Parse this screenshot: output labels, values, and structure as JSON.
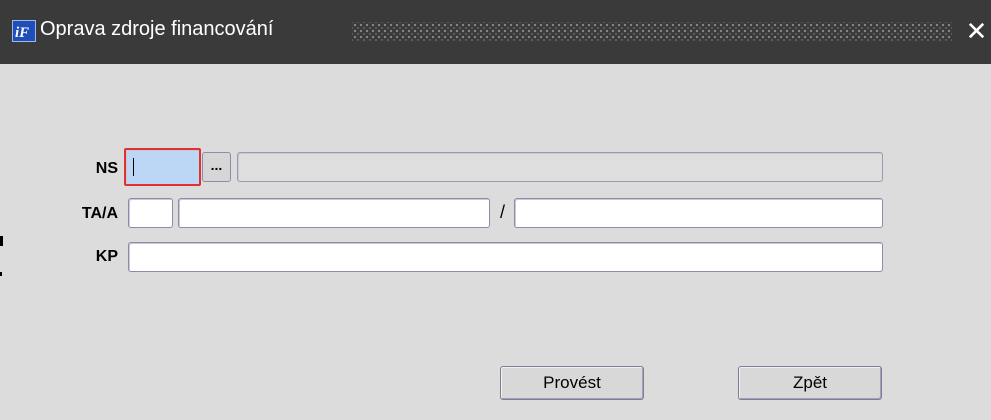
{
  "window": {
    "title": "Oprava zdroje financování",
    "close_glyph": "✕",
    "icon": "app-logo-icon"
  },
  "form": {
    "ns": {
      "label": "NS",
      "code_value": "",
      "lov_label": "...",
      "description_value": ""
    },
    "taa": {
      "label": "TA/A",
      "field1_value": "",
      "field2_value": "",
      "separator": "/",
      "field3_value": ""
    },
    "kp": {
      "label": "KP",
      "value": ""
    }
  },
  "buttons": {
    "execute_label": "Provést",
    "back_label": "Zpět"
  },
  "colors": {
    "titlebar": "#3a3a3a",
    "background": "#dcdcdc",
    "active_field_border": "#e03030",
    "active_field_fill": "#bcd6f5"
  }
}
